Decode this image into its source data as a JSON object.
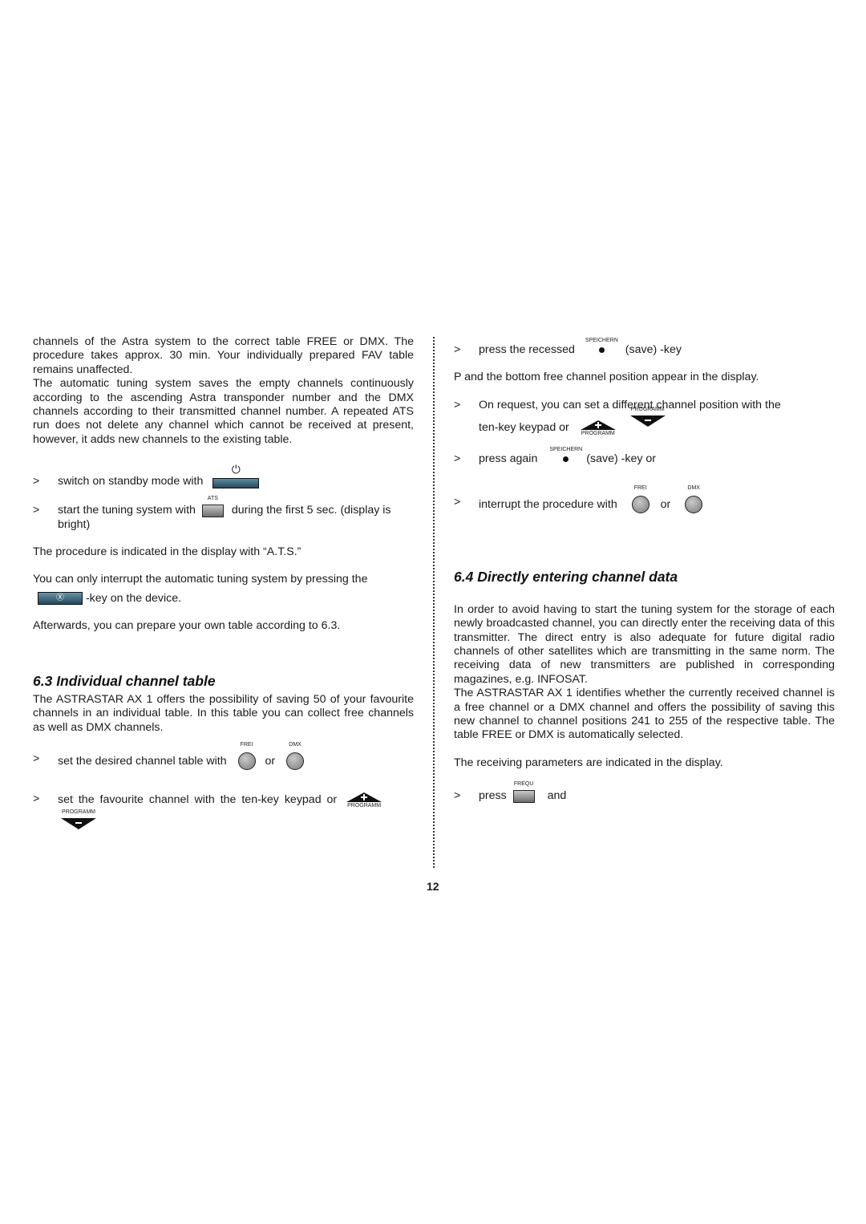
{
  "page_number": "12",
  "left": {
    "intro_p1": "channels of the Astra system to the correct table FREE or DMX. The procedure takes approx. 30 min. Your individually prepared FAV table remains unaffected.",
    "intro_p2": "The automatic tuning system saves the empty channels continuously according to the ascending Astra transponder number and the DMX channels according to their transmitted channel number. A repeated ATS run does not delete any channel which cannot be received at present, however, it adds new channels to the existing table.",
    "step1": {
      "marker": ">",
      "text": "switch on standby mode with"
    },
    "step2": {
      "marker": ">",
      "text_before": "start the tuning system with",
      "key_label": "ATS",
      "text_after": "during the first 5 sec. (display is bright)"
    },
    "p_ats": "The procedure is indicated in the display with “A.T.S.”",
    "p_interrupt": "You can only interrupt the automatic tuning system by pressing the",
    "p_interrupt_after": "-key on the device.",
    "p_afterwards": "Afterwards, you can prepare your own table according to 6.3.",
    "section63": {
      "heading": "6.3 Individual channel table",
      "body": "The ASTRASTAR AX 1 offers the possibility of saving 50 of your favourite channels in an individual table. In this table you can collect free channels as well as DMX channels.",
      "step1": {
        "marker": ">",
        "text": "set the desired channel table with",
        "key1": "FREI",
        "or": "or",
        "key2": "DMX"
      },
      "step2": {
        "marker": ">",
        "text": "set the favourite channel with the ten-key keypad or",
        "key_up": "PROGRAMM",
        "key_down": "PROGRAMM"
      }
    }
  },
  "right": {
    "step1": {
      "marker": ">",
      "text_before": "press the recessed",
      "key_label": "SPEICHERN",
      "text_after": "(save) -key"
    },
    "p_display": "P and the bottom free channel position appear in the display.",
    "step2": {
      "marker": ">",
      "text": "On request, you can set a different channel position with the",
      "text2": "ten-key keypad or",
      "key_up": "PROGRAMM",
      "key_down": "PROGRAMM"
    },
    "step3": {
      "marker": ">",
      "text_before": "press again",
      "key_label": "SPEICHERN",
      "text_after": "(save) -key or"
    },
    "step4": {
      "marker": ">",
      "text": "interrupt the procedure with",
      "key1": "FREI",
      "or": "or",
      "key2": "DMX"
    },
    "section64": {
      "heading": "6.4 Directly entering channel data",
      "body1": "In order to avoid having to start the tuning system for the storage of each newly broadcasted channel, you can directly enter the receiving data of this transmitter. The direct entry is also adequate for future digital radio channels of other satellites which are transmitting in the same norm. The receiving data of new transmitters are published in corresponding magazines, e.g. INFOSAT.",
      "body2": "The ASTRASTAR AX 1 identifies whether the currently received channel is a free channel or a DMX channel and offers the possibility of saving this new channel to channel positions 241 to 255 of the respective table. The table FREE or DMX is automatically selected.",
      "p_params": "The receiving parameters are indicated in the display.",
      "step": {
        "marker": ">",
        "text_before": "press",
        "key_label": "FREQU",
        "text_after": "and"
      }
    }
  }
}
